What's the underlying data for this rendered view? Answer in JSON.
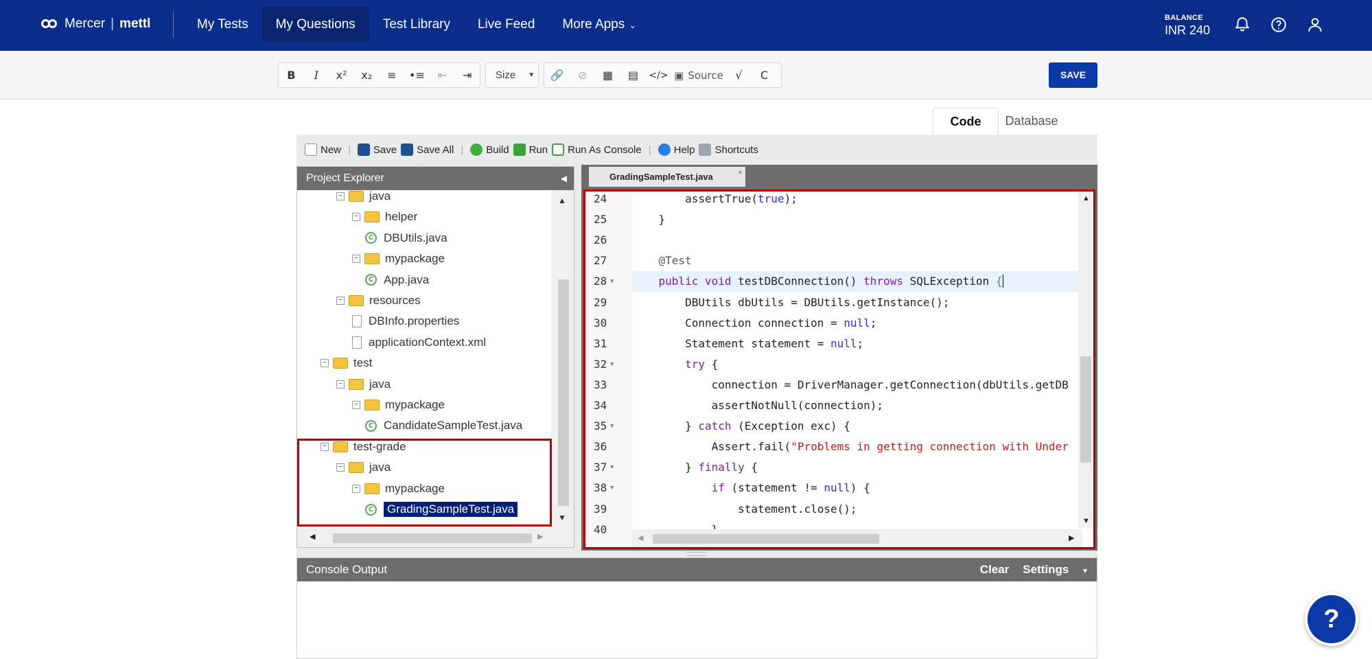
{
  "topbar": {
    "brand": "Mercer",
    "brand_sep": "|",
    "brand_product": "mettl",
    "nav": [
      {
        "label": "My Tests"
      },
      {
        "label": "My Questions"
      },
      {
        "label": "Test Library"
      },
      {
        "label": "Live Feed"
      },
      {
        "label": "More Apps"
      }
    ],
    "balance_label": "BALANCE",
    "balance_value": "INR 240"
  },
  "editor_toolbar": {
    "size_label": "Size",
    "source_label": "Source",
    "save_label": "SAVE"
  },
  "tabs": [
    {
      "label": "Code"
    },
    {
      "label": "Database"
    }
  ],
  "ide_toolbar": [
    {
      "label": "New"
    },
    {
      "label": "Save"
    },
    {
      "label": "Save All"
    },
    {
      "label": "Build"
    },
    {
      "label": "Run"
    },
    {
      "label": "Run As Console"
    },
    {
      "label": "Help"
    },
    {
      "label": "Shortcuts"
    }
  ],
  "project_explorer": {
    "title": "Project Explorer",
    "nodes": [
      {
        "label": "java",
        "kind": "folder",
        "level": 2
      },
      {
        "label": "helper",
        "kind": "folder",
        "level": 3
      },
      {
        "label": "DBUtils.java",
        "kind": "class",
        "level": 4
      },
      {
        "label": "mypackage",
        "kind": "folder",
        "level": 3
      },
      {
        "label": "App.java",
        "kind": "class",
        "level": 4
      },
      {
        "label": "resources",
        "kind": "folder",
        "level": 2
      },
      {
        "label": "DBInfo.properties",
        "kind": "file",
        "level": 3
      },
      {
        "label": "applicationContext.xml",
        "kind": "file",
        "level": 3
      },
      {
        "label": "test",
        "kind": "folder",
        "level": 1
      },
      {
        "label": "java",
        "kind": "folder",
        "level": 2
      },
      {
        "label": "mypackage",
        "kind": "folder",
        "level": 3
      },
      {
        "label": "CandidateSampleTest.java",
        "kind": "class",
        "level": 4
      },
      {
        "label": "test-grade",
        "kind": "folder",
        "level": 1
      },
      {
        "label": "java",
        "kind": "folder",
        "level": 2
      },
      {
        "label": "mypackage",
        "kind": "folder",
        "level": 3
      },
      {
        "label": "GradingSampleTest.java",
        "kind": "class",
        "level": 4,
        "selected": true
      }
    ]
  },
  "code_editor": {
    "tab_label": "GradingSampleTest.java",
    "tab_close": "×",
    "lines": [
      {
        "n": "24",
        "text": "        assertTrue(true);"
      },
      {
        "n": "25",
        "text": "    }"
      },
      {
        "n": "26",
        "text": ""
      },
      {
        "n": "27",
        "text": "    @Test"
      },
      {
        "n": "28",
        "text": "    public void testDBConnection() throws SQLException {",
        "fold": true,
        "current": true
      },
      {
        "n": "29",
        "text": "        DBUtils dbUtils = DBUtils.getInstance();"
      },
      {
        "n": "30",
        "text": "        Connection connection = null;"
      },
      {
        "n": "31",
        "text": "        Statement statement = null;"
      },
      {
        "n": "32",
        "text": "        try {",
        "fold": true
      },
      {
        "n": "33",
        "text": "            connection = DriverManager.getConnection(dbUtils.getDB"
      },
      {
        "n": "34",
        "text": "            assertNotNull(connection);"
      },
      {
        "n": "35",
        "text": "        } catch (Exception exc) {",
        "fold": true
      },
      {
        "n": "36",
        "text": "            Assert.fail(\"Problems in getting connection with Under"
      },
      {
        "n": "37",
        "text": "        } finally {",
        "fold": true
      },
      {
        "n": "38",
        "text": "            if (statement != null) {",
        "fold": true
      },
      {
        "n": "39",
        "text": "                statement.close();"
      },
      {
        "n": "40",
        "text": "            }"
      }
    ]
  },
  "console": {
    "title": "Console Output",
    "clear_label": "Clear",
    "settings_label": "Settings"
  },
  "help_fab": "?",
  "colors": {
    "brand": "#0a2d8c",
    "accent": "#0b3aa8",
    "highlight": "#b40000",
    "selection": "#001f7a"
  }
}
